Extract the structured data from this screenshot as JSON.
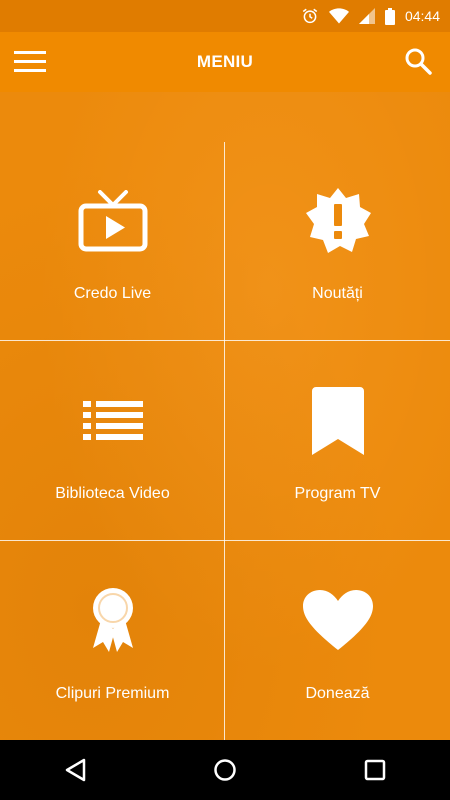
{
  "status_bar": {
    "time": "04:44"
  },
  "app_bar": {
    "title": "MENIU"
  },
  "tiles": [
    {
      "label": "Credo Live"
    },
    {
      "label": "Noutăți"
    },
    {
      "label": "Biblioteca Video"
    },
    {
      "label": "Program TV"
    },
    {
      "label": "Clipuri Premium"
    },
    {
      "label": "Donează"
    }
  ],
  "colors": {
    "status_bar": "#e07c00",
    "app_bar": "#f08a00",
    "background": "#ec8a0c",
    "icon": "#ffffff",
    "nav_bar": "#000000"
  },
  "icons": {
    "menu": "hamburger-icon",
    "search": "search-icon",
    "tiles": [
      "tv-icon",
      "alert-badge-icon",
      "list-icon",
      "bookmark-icon",
      "award-ribbon-icon",
      "heart-icon"
    ]
  }
}
